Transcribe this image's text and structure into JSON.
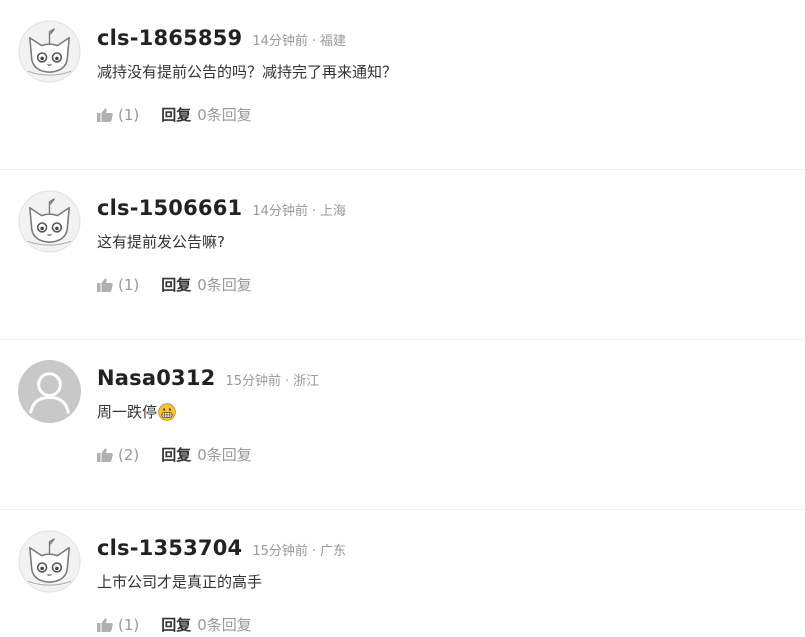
{
  "comments": [
    {
      "username": "cls-1865859",
      "time": "14分钟前",
      "separator": "·",
      "location": "福建",
      "text": "减持没有提前公告的吗？减持完了再来通知？",
      "likes": "(1)",
      "reply_label": "回复",
      "reply_count": "0条回复",
      "avatar": "cat-avatar-icon"
    },
    {
      "username": "cls-1506661",
      "time": "14分钟前",
      "separator": "·",
      "location": "上海",
      "text": "这有提前发公告嘛?",
      "likes": "(1)",
      "reply_label": "回复",
      "reply_count": "0条回复",
      "avatar": "cat-avatar-icon"
    },
    {
      "username": "Nasa0312",
      "time": "15分钟前",
      "separator": "·",
      "location": "浙江",
      "text": "周一跌停",
      "emoji": "grimace-emoji-icon",
      "likes": "(2)",
      "reply_label": "回复",
      "reply_count": "0条回复",
      "avatar": "default-user-avatar-icon"
    },
    {
      "username": "cls-1353704",
      "time": "15分钟前",
      "separator": "·",
      "location": "广东",
      "text": "上市公司才是真正的高手",
      "likes": "(1)",
      "reply_label": "回复",
      "reply_count": "0条回复",
      "avatar": "cat-avatar-icon"
    }
  ],
  "colors": {
    "username": "#222222",
    "meta": "#999999",
    "text": "#333333",
    "divider": "#eeeeee",
    "avatar_gray": "#c8c8c8"
  }
}
